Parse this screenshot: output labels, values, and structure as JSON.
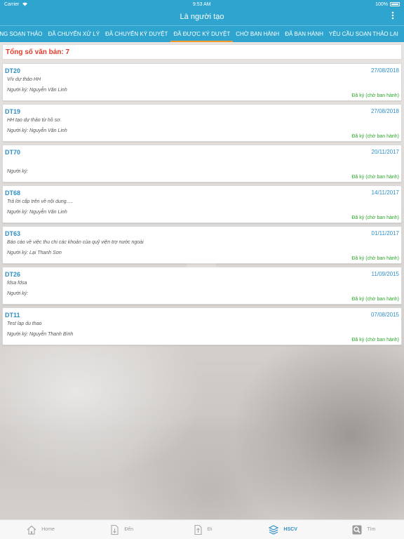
{
  "status": {
    "carrier": "Carrier",
    "time": "9:53 AM",
    "battery": "100%"
  },
  "header": {
    "title": "Là người tạo"
  },
  "tabs": [
    {
      "label": "ANG SOẠN THẢO"
    },
    {
      "label": "ĐÃ CHUYỂN XỬ LÝ"
    },
    {
      "label": "ĐÃ CHUYỂN KÝ DUYỆT"
    },
    {
      "label": "ĐÃ ĐƯỢC KÝ DUYỆT"
    },
    {
      "label": "CHỜ BAN HÀNH"
    },
    {
      "label": "ĐÃ BAN HÀNH"
    },
    {
      "label": "YÊU CẦU SOẠN THẢO LẠI"
    }
  ],
  "active_tab_index": 3,
  "summary": {
    "total_label": "Tổng số văn bản: 7"
  },
  "documents": [
    {
      "code": "DT20",
      "date": "27/08/2018",
      "summary": "V/v dự thảo HH",
      "signer": "Người ký: Nguyễn Văn Linh",
      "status": "Đã ký (chờ ban hành)"
    },
    {
      "code": "DT19",
      "date": "27/08/2018",
      "summary": "HH tạo dự thảo từ hồ sơ.",
      "signer": "Người ký: Nguyễn Văn Linh",
      "status": "Đã ký (chờ ban hành)"
    },
    {
      "code": "DT70",
      "date": "20/11/2017",
      "summary": "",
      "signer": "Người ký:",
      "status": "Đã ký (chờ ban hành)"
    },
    {
      "code": "DT68",
      "date": "14/11/2017",
      "summary": "Trả lời cấp trên về nội dung.....",
      "signer": "Người ký: Nguyễn Văn Linh",
      "status": "Đã ký (chờ ban hành)"
    },
    {
      "code": "DT63",
      "date": "01/11/2017",
      "summary": "Báo cáo về việc thu chi các khoản của quỹ viện trợ nước ngoài",
      "signer": "Người ký: Lại Thanh Sơn",
      "status": "Đã ký (chờ ban hành)"
    },
    {
      "code": "DT26",
      "date": "11/09/2015",
      "summary": "fdsa fdsa",
      "signer": "Người ký:",
      "status": "Đã ký (chờ ban hành)"
    },
    {
      "code": "DT11",
      "date": "07/08/2015",
      "summary": "Test lap du thao",
      "signer": "Người ký: Nguyễn Thanh Bình",
      "status": "Đã ký (chờ ban hành)"
    }
  ],
  "tabbar": {
    "items": [
      {
        "label": "Home",
        "icon": "home-icon"
      },
      {
        "label": "Đến",
        "icon": "incoming-doc-icon"
      },
      {
        "label": "Đi",
        "icon": "outgoing-doc-icon"
      },
      {
        "label": "HSCV",
        "icon": "layers-icon"
      },
      {
        "label": "Tìm",
        "icon": "search-icon"
      }
    ],
    "active_index": 3
  },
  "colors": {
    "primary": "#2ea4cf",
    "accent": "#f39a2b",
    "total_text": "#e33a2a",
    "link": "#2e8fc5",
    "status_green": "#2ba52b"
  }
}
